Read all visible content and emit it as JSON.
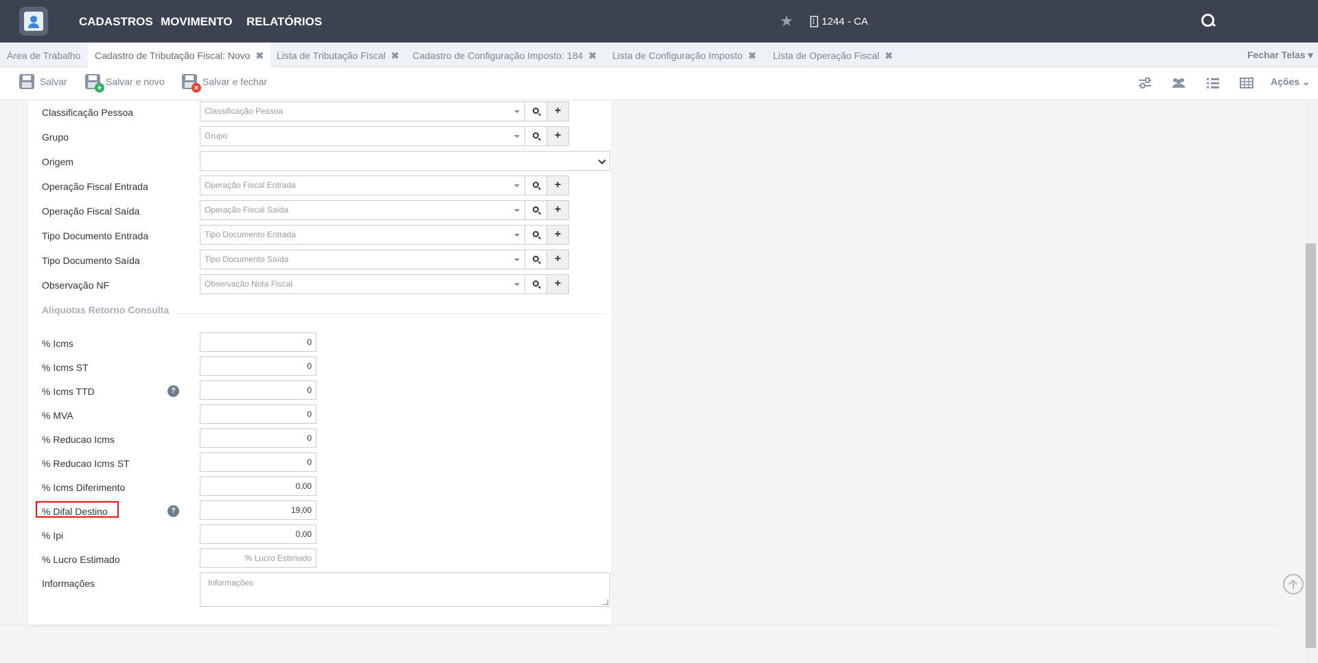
{
  "nav": {
    "items": [
      "CADASTROS",
      "MOVIMENTO",
      "RELATÓRIOS"
    ],
    "company": "1244 - CA"
  },
  "tabs": [
    {
      "label": "Área de Trabalho",
      "closable": false
    },
    {
      "label": "Cadastro de Tributação Fiscal: Novo",
      "closable": true,
      "active": true
    },
    {
      "label": "Lista de Tributação Fiscal",
      "closable": true
    },
    {
      "label": "Cadastro de Configuração Imposto: 184",
      "closable": true
    },
    {
      "label": "Lista de Configuração Imposto",
      "closable": true
    },
    {
      "label": "Lista de Operação Fiscal",
      "closable": true
    }
  ],
  "tab_close_glyph": "✖",
  "close_all_label": "Fechar Telas",
  "toolbar": {
    "save_label": "Salvar",
    "save_new_label": "Salvar e novo",
    "save_close_label": "Salvar e fechar",
    "actions_label": "Ações"
  },
  "form": {
    "lookups": [
      {
        "label": "Classificação Pessoa",
        "placeholder": "Classificação Pessoa"
      },
      {
        "label": "Grupo",
        "placeholder": "Grupo"
      },
      {
        "label": "Origem",
        "placeholder": ""
      },
      {
        "label": "Operação Fiscal Entrada",
        "placeholder": "Operação Fiscal Entrada"
      },
      {
        "label": "Operação Fiscal Saída",
        "placeholder": "Operação Fiscal Saída"
      },
      {
        "label": "Tipo Documento Entrada",
        "placeholder": "Tipo Documento Entrada"
      },
      {
        "label": "Tipo Documento Saída",
        "placeholder": "Tipo Documento Saída"
      },
      {
        "label": "Observação NF",
        "placeholder": "Observação Nota Fiscal"
      }
    ],
    "section_title": "Aliquotas Retorno Consulta",
    "rates": [
      {
        "label": "% Icms",
        "value": "0"
      },
      {
        "label": "% Icms ST",
        "value": "0"
      },
      {
        "label": "% Icms TTD",
        "value": "0",
        "help": true
      },
      {
        "label": "% MVA",
        "value": "0"
      },
      {
        "label": "% Reducao Icms",
        "value": "0"
      },
      {
        "label": "% Reducao Icms ST",
        "value": "0"
      },
      {
        "label": "% Icms Diferimento",
        "value": "0,00"
      },
      {
        "label": "% Difal Destino",
        "value": "19,00",
        "help": true,
        "highlighted": true
      },
      {
        "label": "% Ipi",
        "value": "0,00"
      },
      {
        "label": "% Lucro Estimado",
        "value": "",
        "placeholder": "% Lucro Estimado"
      }
    ],
    "info_label": "Informações",
    "info_placeholder": "Informações"
  }
}
